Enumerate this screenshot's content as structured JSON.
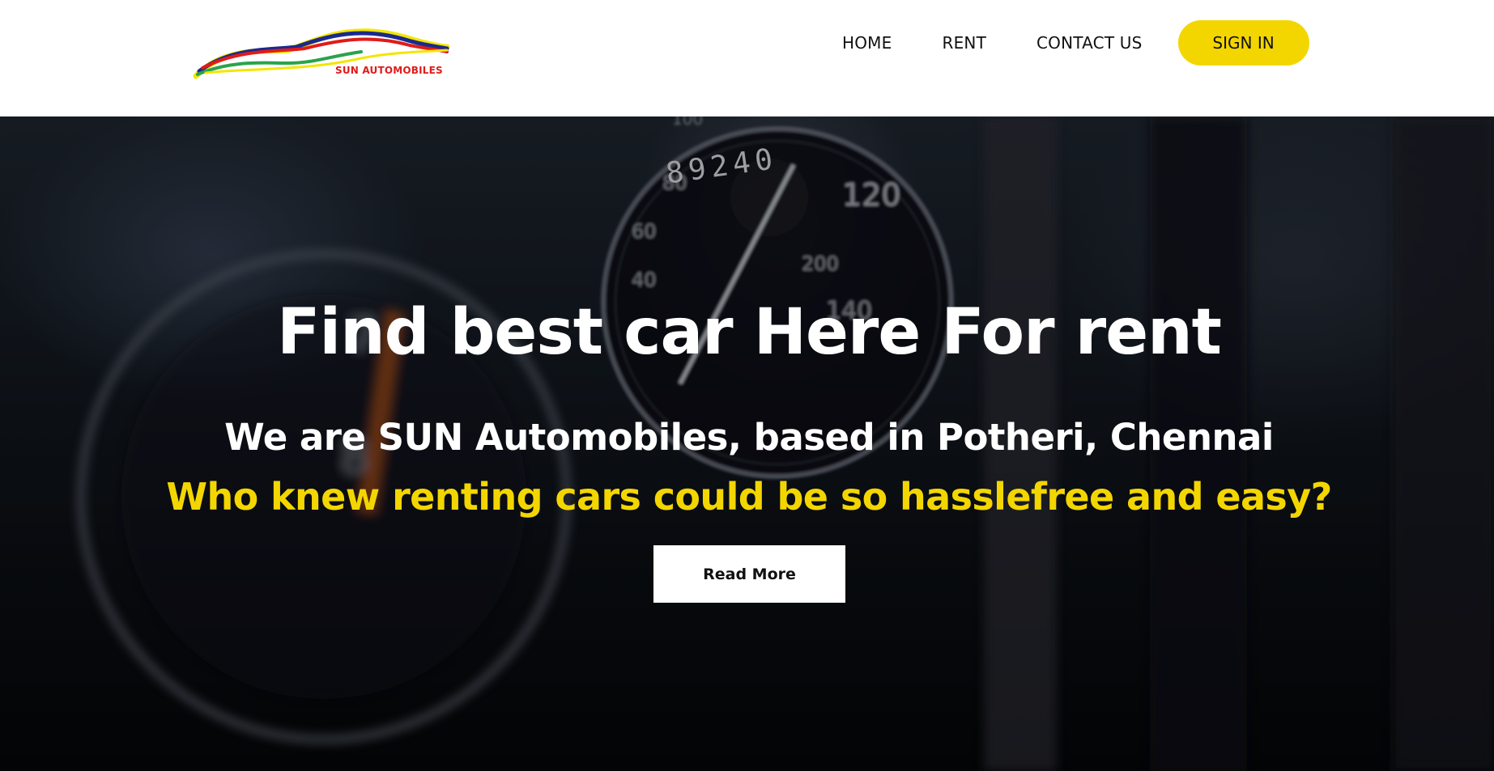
{
  "header": {
    "logo_text": "SUN AUTOMOBILES",
    "nav": [
      {
        "label": "HOME"
      },
      {
        "label": "RENT"
      },
      {
        "label": "CONTACT US"
      }
    ],
    "signin_label": "SIGN IN"
  },
  "hero": {
    "title": "Find best car Here For rent",
    "subtitle": "We are SUN Automobiles, based in Potheri, Chennai",
    "tagline": "Who knew renting cars could be so hasslefree and easy?",
    "cta_label": "Read More",
    "odometer": "89240"
  },
  "colors": {
    "accent": "#f3d600",
    "logo_red": "#e01b1b"
  }
}
